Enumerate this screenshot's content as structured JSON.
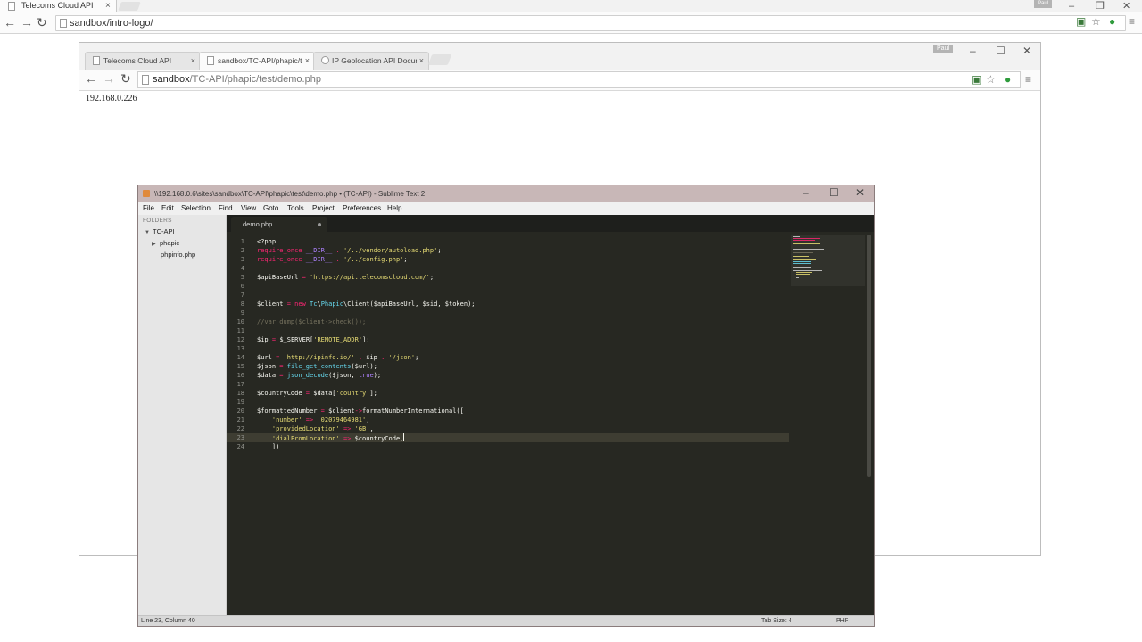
{
  "outer_browser": {
    "tab_title": "Telecoms Cloud API",
    "user_badge": "Paul",
    "url": "sandbox/intro-logo/"
  },
  "inner_browser": {
    "tabs": [
      {
        "label": "Telecoms Cloud API"
      },
      {
        "label": "sandbox/TC-API/phapic/te"
      },
      {
        "label": "IP Geolocation API Docum"
      }
    ],
    "user_badge": "Paul",
    "url_host": "sandbox",
    "url_path": "/TC-API/phapic/test/demo.php",
    "page_text": "192.168.0.226"
  },
  "sublime": {
    "window_title": "\\\\192.168.0.6\\sites\\sandbox\\TC-API\\phapic\\test\\demo.php • (TC-API) - Sublime Text 2",
    "menu": [
      "File",
      "Edit",
      "Selection",
      "Find",
      "View",
      "Goto",
      "Tools",
      "Project",
      "Preferences",
      "Help"
    ],
    "sidebar": {
      "folders_label": "FOLDERS",
      "root": "TC-API",
      "items": [
        "phapic",
        "phpinfo.php"
      ]
    },
    "tab_label": "demo.php",
    "line_numbers": [
      "1",
      "2",
      "3",
      "4",
      "5",
      "6",
      "7",
      "8",
      "9",
      "10",
      "11",
      "12",
      "13",
      "14",
      "15",
      "16",
      "17",
      "18",
      "19",
      "20",
      "21",
      "22",
      "23",
      "24"
    ],
    "status_position": "Line 23, Column 40",
    "status_tab_size": "Tab Size: 4",
    "status_syntax": "PHP"
  },
  "code": {
    "l1": "<?php",
    "l2_kw": "require_once",
    "l2_const": "__DIR__",
    "l2_str": "'/../vendor/autoload.php'",
    "l3_kw": "require_once",
    "l3_const": "__DIR__",
    "l3_str": "'/../config.php'",
    "l5_var": "$apiBaseUrl",
    "l5_str": "'https://api.telecomscloud.com/'",
    "l8_var": "$client",
    "l8_new": "new",
    "l8_ns": "Tc",
    "l8_cls": "Phapic",
    "l8_rest": "Client($apiBaseUrl, $sid, $token);",
    "l10_comment": "//var_dump($client->check());",
    "l12_var": "$ip",
    "l12_rest": "$_SERVER[",
    "l12_str": "'REMOTE_ADDR'",
    "l14_var": "$url",
    "l14_str1": "'http://ipinfo.io/'",
    "l14_mid": "$ip",
    "l14_str2": "'/json'",
    "l15_var": "$json",
    "l15_fn": "file_get_contents",
    "l15_rest": "($url);",
    "l16_var": "$data",
    "l16_fn": "json_decode",
    "l16_rest": "($json, ",
    "l16_true": "true",
    "l18_var": "$countryCode",
    "l18_rest": "$data[",
    "l18_str": "'country'",
    "l20_var": "$formattedNumber",
    "l20_obj": "$client",
    "l20_method": "formatNumberInternational([",
    "l21_key": "'number'",
    "l21_val": "'02079464981'",
    "l22_key": "'providedLocation'",
    "l22_val": "'GB'",
    "l23_key": "'dialFromLocation'",
    "l23_val": "$countryCode,",
    "l24": "])"
  },
  "colors": {
    "editor_bg": "#272822",
    "keyword": "#f92672",
    "string": "#e6db74",
    "comment": "#75715e"
  }
}
